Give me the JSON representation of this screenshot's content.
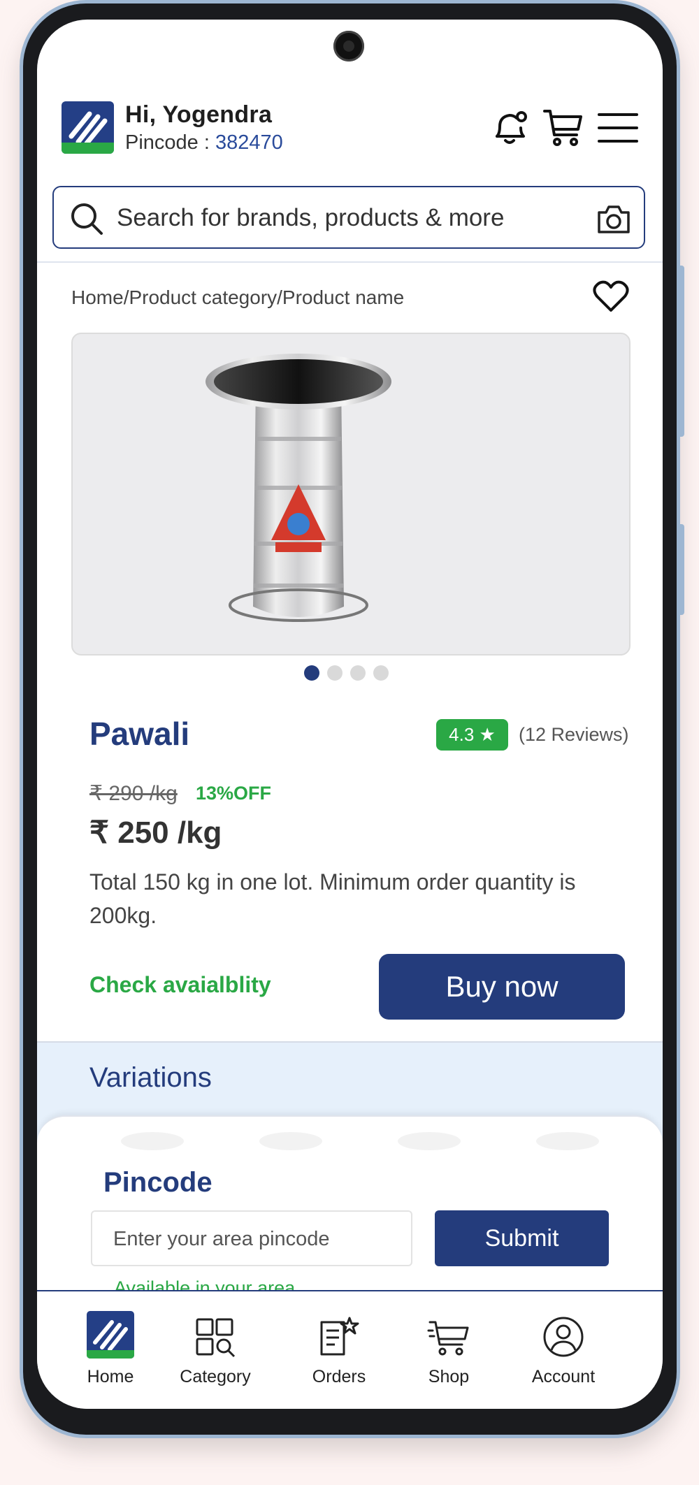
{
  "header": {
    "greeting": "Hi, Yogendra",
    "pincode_label": "Pincode : ",
    "pincode_value": "382470"
  },
  "search": {
    "placeholder": "Search for brands, products & more"
  },
  "breadcrumb": "Home/Product category/Product name",
  "product": {
    "name": "Pawali",
    "rating": "4.3 ★",
    "reviews": "(12 Reviews)",
    "old_price": "₹ 290 /kg",
    "discount": "13%OFF",
    "price": "₹ 250 /kg",
    "description": "Total 150 kg in one lot. Minimum order quantity is 200kg.",
    "check_label": "Check avaialblity",
    "buy_label": "Buy now",
    "image_dots": 4,
    "active_dot": 1
  },
  "variations": {
    "title": "Variations"
  },
  "pincode_sheet": {
    "title": "Pincode",
    "placeholder": "Enter your area pincode",
    "submit_label": "Submit",
    "status": "Available in your area"
  },
  "bottom_nav": {
    "home": "Home",
    "category": "Category",
    "orders": "Orders",
    "shop": "Shop",
    "account": "Account"
  },
  "colors": {
    "brand_blue": "#243c7c",
    "brand_green": "#2aa845",
    "variations_bg": "#e6f0fb"
  }
}
